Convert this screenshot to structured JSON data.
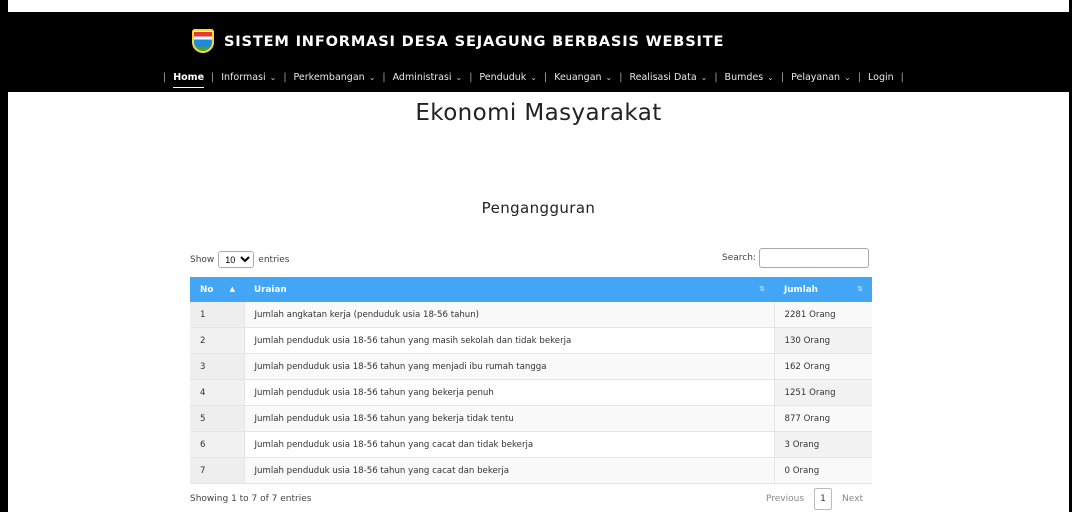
{
  "header": {
    "title": "SISTEM INFORMASI DESA SEJAGUNG BERBASIS WEBSITE",
    "logo": "village-crest-icon"
  },
  "nav": {
    "items": [
      {
        "label": "Home",
        "dropdown": false,
        "active": true
      },
      {
        "label": "Informasi",
        "dropdown": true
      },
      {
        "label": "Perkembangan",
        "dropdown": true
      },
      {
        "label": "Administrasi",
        "dropdown": true
      },
      {
        "label": "Penduduk",
        "dropdown": true
      },
      {
        "label": "Keuangan",
        "dropdown": true
      },
      {
        "label": "Realisasi Data",
        "dropdown": true
      },
      {
        "label": "Bumdes",
        "dropdown": true
      },
      {
        "label": "Pelayanan",
        "dropdown": true
      },
      {
        "label": "Login",
        "dropdown": false
      }
    ],
    "chevron": "⌄"
  },
  "page": {
    "title": "Ekonomi Masyarakat",
    "section_title": "Pengangguran"
  },
  "table_controls": {
    "show_label": "Show",
    "entries_label": "entries",
    "length_value": "10",
    "search_label": "Search:",
    "search_value": ""
  },
  "table": {
    "headers": {
      "no": "No",
      "uraian": "Uraian",
      "jumlah": "Jumlah"
    },
    "sort_indicator_active": "▲",
    "sort_indicator": "⇅",
    "rows": [
      {
        "no": "1",
        "uraian": "Jumlah angkatan kerja (penduduk usia 18-56 tahun)",
        "jumlah": "2281 Orang"
      },
      {
        "no": "2",
        "uraian": "Jumlah penduduk usia 18-56 tahun yang masih sekolah dan tidak bekerja",
        "jumlah": "130 Orang"
      },
      {
        "no": "3",
        "uraian": "Jumlah penduduk usia 18-56 tahun yang menjadi ibu rumah tangga",
        "jumlah": "162 Orang"
      },
      {
        "no": "4",
        "uraian": "Jumlah penduduk usia 18-56 tahun yang bekerja penuh",
        "jumlah": "1251 Orang"
      },
      {
        "no": "5",
        "uraian": "Jumlah penduduk usia 18-56 tahun yang bekerja tidak tentu",
        "jumlah": "877 Orang"
      },
      {
        "no": "6",
        "uraian": "Jumlah penduduk usia 18-56 tahun yang cacat dan tidak bekerja",
        "jumlah": "3 Orang"
      },
      {
        "no": "7",
        "uraian": "Jumlah penduduk usia 18-56 tahun yang cacat dan bekerja",
        "jumlah": "0 Orang"
      }
    ]
  },
  "footer": {
    "info": "Showing 1 to 7 of 7 entries",
    "previous": "Previous",
    "page": "1",
    "next": "Next"
  }
}
